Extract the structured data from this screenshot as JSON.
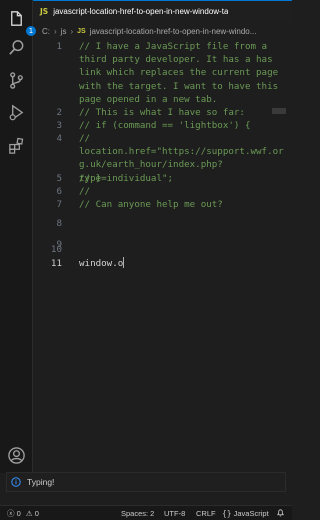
{
  "tab": {
    "language_badge": "JS",
    "title": "javascript-location-href-to-open-in-new-window-ta"
  },
  "breadcrumb": {
    "drive": "C:",
    "folder": "js",
    "file_badge": "JS",
    "file": "javascript-location-href-to-open-in-new-windo..."
  },
  "activity_bar": {
    "items": [
      "files-icon",
      "search-icon",
      "source-control-icon",
      "run-debug-icon",
      "extensions-icon"
    ],
    "files_badge": "1",
    "bottom_items": [
      "account-icon"
    ]
  },
  "editor": {
    "active_line": 11,
    "lines": [
      {
        "num": "1",
        "text": "// I have a JavaScript file from a third party developer. It has a has link which replaces the current page with the target. I want to have this page opened in a new tab."
      },
      {
        "num": "2",
        "text": "// This is what I have so far:"
      },
      {
        "num": "3",
        "text": "// if (command == 'lightbox') {"
      },
      {
        "num": "4",
        "text": "//  location.href=\"https://support.wwf.org.uk/earth_hour/index.php?type=individual\";"
      },
      {
        "num": "5",
        "text": "// }"
      },
      {
        "num": "6",
        "text": "//"
      },
      {
        "num": "7",
        "text": "// Can anyone help me out?"
      },
      {
        "num": "8",
        "text": ""
      },
      {
        "num": "9",
        "text": ""
      },
      {
        "num": "10",
        "text": ""
      },
      {
        "num": "11",
        "text": "window.o"
      }
    ]
  },
  "notification": {
    "icon": "info-icon",
    "text": "Typing!"
  },
  "status_bar": {
    "errors": "0",
    "warnings": "0",
    "spaces": "Spaces: 2",
    "encoding": "UTF-8",
    "eol": "CRLF",
    "language_glyph": "{}",
    "language": "JavaScript",
    "notifications_icon": "bell-icon"
  },
  "colors": {
    "accent": "#0078d4",
    "comment": "#6a9955",
    "js_badge": "#cbcb41",
    "background": "#1e1e1e"
  }
}
